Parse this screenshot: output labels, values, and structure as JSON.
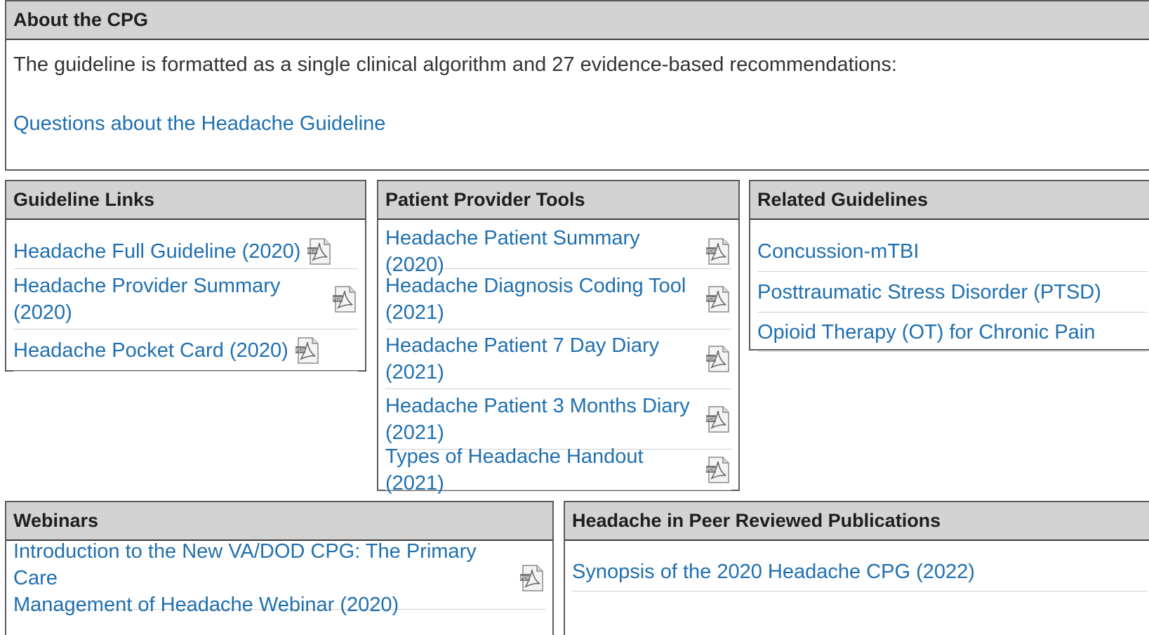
{
  "about": {
    "title": "About the CPG",
    "intro": "The guideline is formatted as a single clinical algorithm and 27 evidence-based recommendations:",
    "link": "Questions about the Headache Guideline"
  },
  "guideline_links": {
    "title": "Guideline Links",
    "items": [
      {
        "label_line1": "Headache Full Guideline (2020)",
        "label_line2": "",
        "icon": "pdf-icon"
      },
      {
        "label_line1": "Headache Provider Summary",
        "label_line2": "(2020)",
        "icon": "pdf-icon"
      },
      {
        "label_line1": "Headache Pocket Card (2020)",
        "label_line2": "",
        "icon": "pdf-icon"
      }
    ]
  },
  "patient_tools": {
    "title": "Patient Provider Tools",
    "items": [
      {
        "label_line1": "Headache Patient Summary (2020)",
        "label_line2": "",
        "icon": "pdf-icon"
      },
      {
        "label_line1": "Headache Diagnosis Coding Tool",
        "label_line2": "(2021)",
        "icon": "pdf-icon"
      },
      {
        "label_line1": "Headache Patient 7 Day Diary",
        "label_line2": "(2021)",
        "icon": "pdf-icon"
      },
      {
        "label_line1": "Headache Patient 3 Months Diary",
        "label_line2": "(2021)",
        "icon": "pdf-icon"
      },
      {
        "label_line1": "Types of Headache Handout (2021)",
        "label_line2": "",
        "icon": "pdf-icon"
      }
    ]
  },
  "related": {
    "title": "Related Guidelines",
    "items": [
      "Concussion-mTBI",
      "Posttraumatic Stress Disorder (PTSD)",
      "Opioid Therapy (OT) for Chronic Pain"
    ]
  },
  "webinars": {
    "title": "Webinars",
    "items": [
      {
        "label_line1": "Introduction to the New VA/DOD CPG: The Primary Care",
        "label_line2": "Management of Headache Webinar (2020)",
        "icon": "pdf-icon"
      }
    ]
  },
  "peer": {
    "title": "Headache in Peer Reviewed Publications",
    "items": [
      "Synopsis of the 2020 Headache CPG (2022)"
    ]
  },
  "colors": {
    "link": "#1f6fb0",
    "header_bg": "#d3d3d3",
    "border": "#5a5a5a"
  }
}
